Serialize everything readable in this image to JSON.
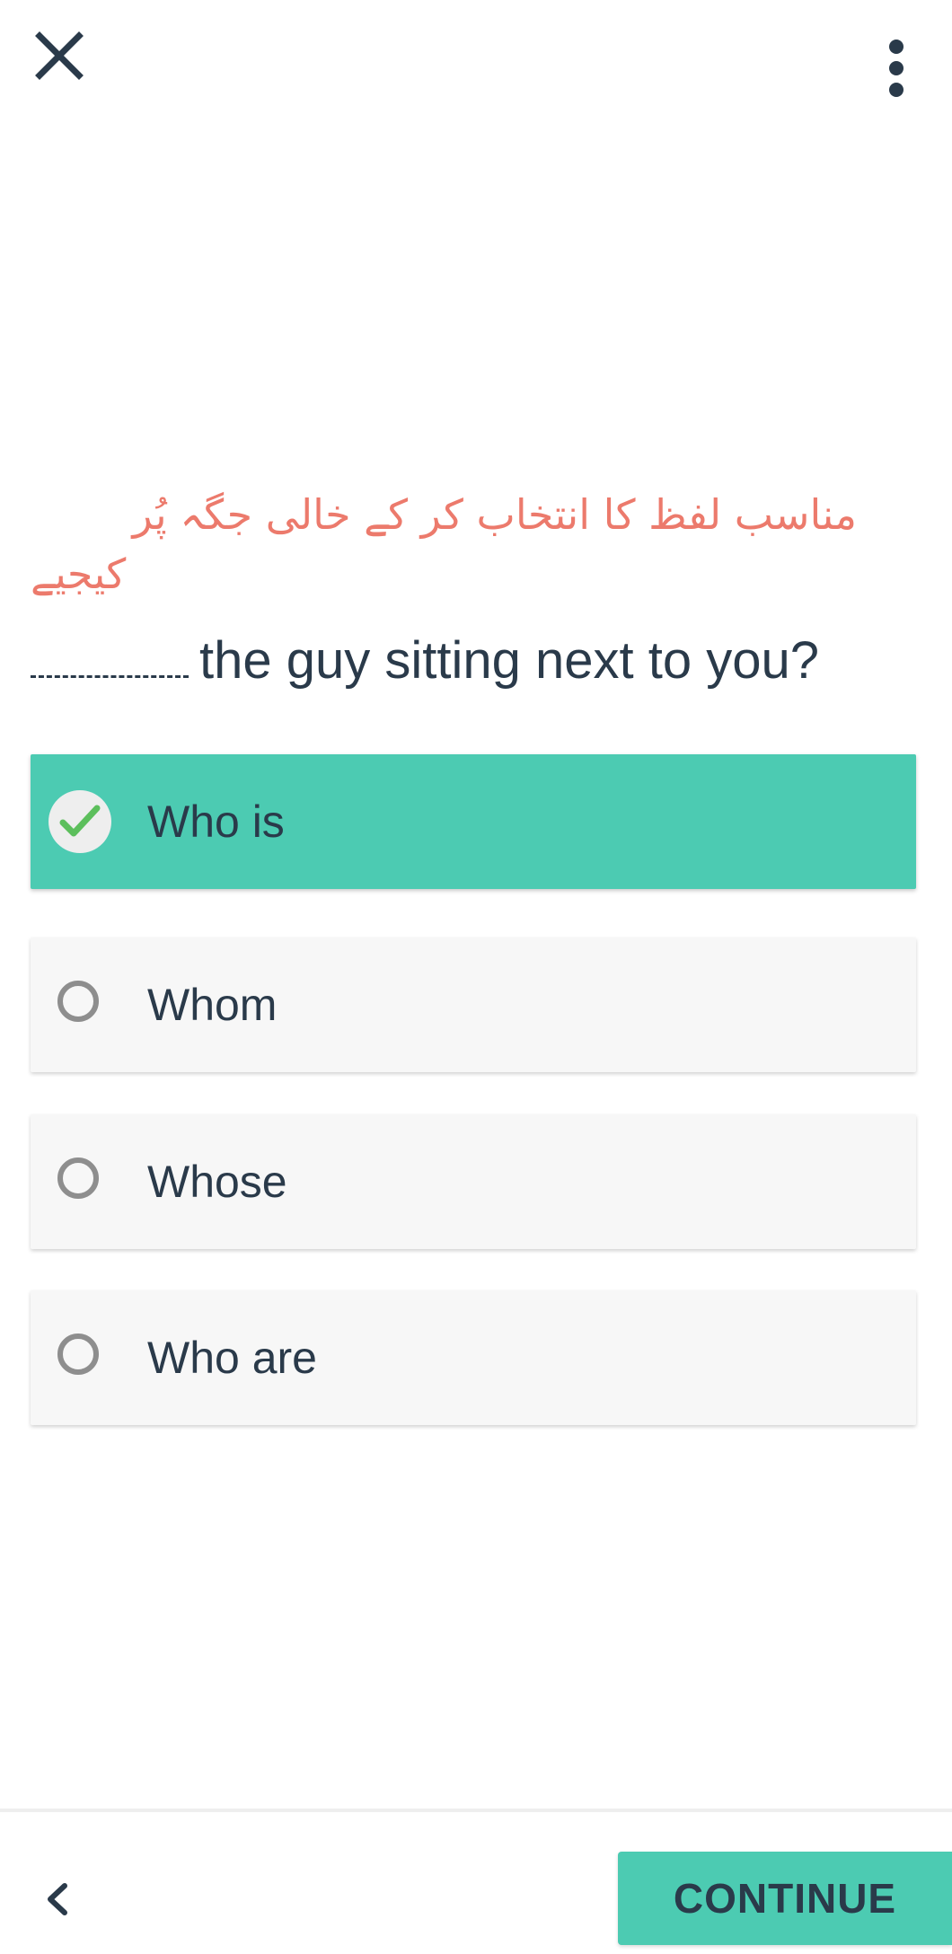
{
  "header": {
    "close_icon": "close-icon",
    "more_icon": "more-vertical-icon"
  },
  "instruction": {
    "line1": "مناسب لفظ کا انتخاب کر کے خالی جگہ پُر",
    "line2": "کیجیے",
    "color": "#ec7a6c"
  },
  "question": {
    "text": "the guy sitting next to you?"
  },
  "options": [
    {
      "label": "Who is",
      "selected": true
    },
    {
      "label": "Whom",
      "selected": false
    },
    {
      "label": "Whose",
      "selected": false
    },
    {
      "label": "Who are",
      "selected": false
    }
  ],
  "footer": {
    "back_icon": "chevron-left-icon",
    "continue_label": "CONTINUE"
  },
  "colors": {
    "accent": "#4ccbb2",
    "text": "#2a3a4a",
    "option_bg": "#f7f7f7",
    "check": "#5cbf5c"
  }
}
